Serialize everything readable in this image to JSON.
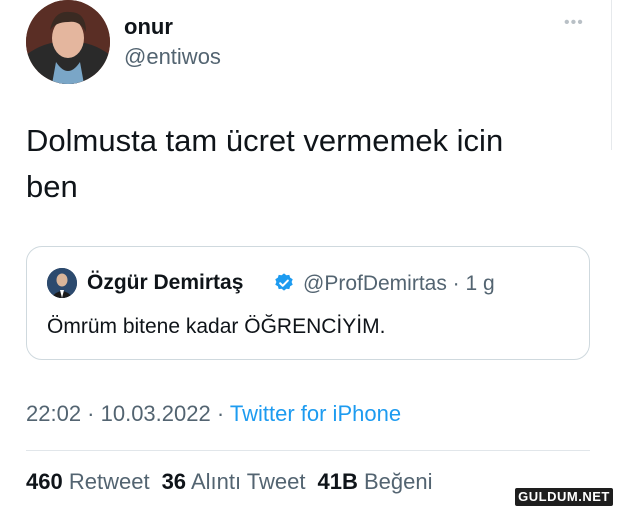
{
  "author": {
    "display_name": "onur",
    "handle": "@entiwos"
  },
  "tweet": {
    "text_line1": "Dolmusta tam ücret vermemek icin",
    "text_line2": "ben"
  },
  "quoted_tweet": {
    "display_name": "Özgür Demirtaş",
    "handle_time": "@ProfDemirtas · 1 g",
    "text": "Ömrüm bitene kadar ÖĞRENCİYİM.",
    "verified": true
  },
  "meta": {
    "time_date": "22:02 · 10.03.2022 · ",
    "source": "Twitter for iPhone"
  },
  "stats": {
    "retweets_count": "460",
    "retweets_label": "Retweet",
    "quotes_count": "36",
    "quotes_label": "Alıntı Tweet",
    "likes_count": "41B",
    "likes_label": "Beğeni"
  },
  "watermark": "GULDUM.NET",
  "colors": {
    "link": "#1d9bf0",
    "secondary_text": "#536471",
    "primary_text": "#0f1419",
    "border": "#cfd9de"
  }
}
